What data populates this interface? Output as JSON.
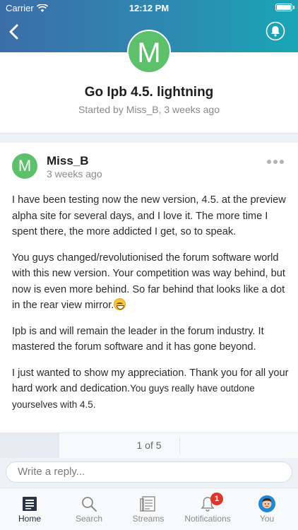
{
  "status": {
    "carrier": "Carrier",
    "time": "12:12 PM"
  },
  "topic": {
    "avatar_letter": "M",
    "title": "Go Ipb 4.5. lightning",
    "meta": "Started by Miss_B, 3 weeks ago"
  },
  "post": {
    "avatar_letter": "M",
    "author": "Miss_B",
    "time": "3 weeks ago",
    "paragraphs": [
      "I have been testing now the new version, 4.5. at the preview alpha site for several days, and I love it. The more time I spent there, the more addicted I get, so to speak.",
      "You guys changed/revolutionised the forum software world with this new version. Your competition was way behind, but now is even more behind. So far behind that looks like a dot in the rear view mirror.",
      "Ipb is and will remain the leader in the forum industry.  It mastered the forum software and it has gone beyond.",
      "I just wanted to show my appreciation. Thank you for all your hard work and dedication."
    ],
    "closing_small": "You guys really have outdone yourselves with 4.5."
  },
  "pager": {
    "label": "1 of 5",
    "progress_fraction": 0.2
  },
  "reply": {
    "placeholder": "Write a reply..."
  },
  "tabs": [
    {
      "label": "Home",
      "icon": "home-icon"
    },
    {
      "label": "Search",
      "icon": "search-icon"
    },
    {
      "label": "Streams",
      "icon": "streams-icon"
    },
    {
      "label": "Notifications",
      "icon": "bell-icon",
      "badge": "1"
    },
    {
      "label": "You",
      "icon": "user-avatar-icon"
    }
  ],
  "colors": {
    "header_start": "#3b6ea8",
    "header_end": "#19a6b6",
    "avatar_green": "#5cc16a",
    "badge_red": "#e0352b"
  }
}
